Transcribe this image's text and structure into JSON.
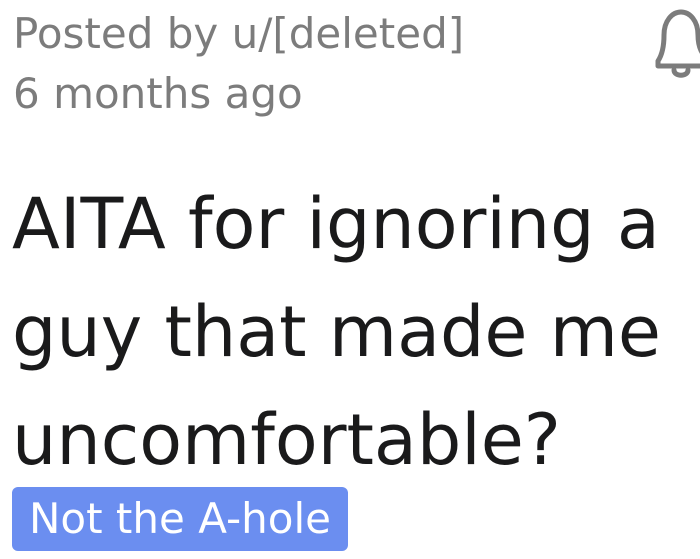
{
  "post": {
    "posted_by": "Posted by u/[deleted]",
    "timestamp": "6 months ago",
    "title_lines": [
      "AITA for ignoring a",
      "guy that made me",
      "uncomfortable?"
    ],
    "flair": "Not the A-hole"
  },
  "icons": {
    "notification": "bell-icon"
  },
  "colors": {
    "meta_text": "#7c7c7c",
    "title_text": "#1a1a1b",
    "flair_background": "#6b8ef0",
    "flair_text": "#ffffff",
    "icon": "#7c7c7c"
  }
}
